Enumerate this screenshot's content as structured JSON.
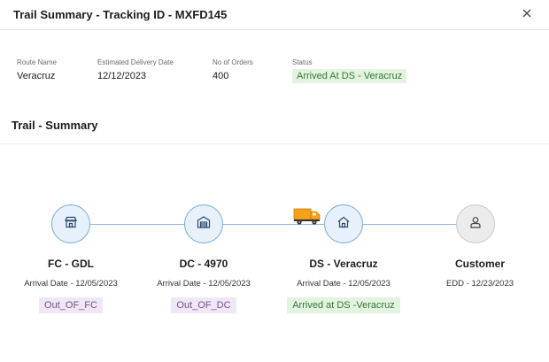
{
  "header": {
    "title": "Trail Summary - Tracking ID - MXFD145"
  },
  "info": {
    "route_name": {
      "label": "Route Name",
      "value": "Veracruz"
    },
    "estimated_delivery": {
      "label": "Estimated Delivery Date",
      "value": "12/12/2023"
    },
    "orders": {
      "label": "No of Orders",
      "value": "400"
    },
    "status": {
      "label": "Status",
      "value": "Arrived At DS - Veracruz",
      "color": "#2f7a2c"
    }
  },
  "section": {
    "title": "Trail - Summary"
  },
  "trail": {
    "nodes": [
      {
        "name": "FC - GDL",
        "date": "Arrival Date   - 12/05/2023",
        "badge": "Out_OF_FC",
        "icon": "store-icon",
        "state": "active"
      },
      {
        "name": "DC - 4970",
        "date": "Arrival Date   - 12/05/2023",
        "badge": "Out_OF_DC",
        "icon": "warehouse-icon",
        "state": "active"
      },
      {
        "name": "DS - Veracruz",
        "date": "Arrival Date - 12/05/2023",
        "badge": "Arrived at DS -Veracruz",
        "icon": "home-icon",
        "state": "active"
      },
      {
        "name": "Customer",
        "date": "EDD - 12/23/2023",
        "badge": "",
        "icon": "user-icon",
        "state": "pending"
      }
    ],
    "current_position_icon": "truck-icon",
    "colors": {
      "line": "#8fb6da",
      "truck": "#f5a21b"
    }
  }
}
